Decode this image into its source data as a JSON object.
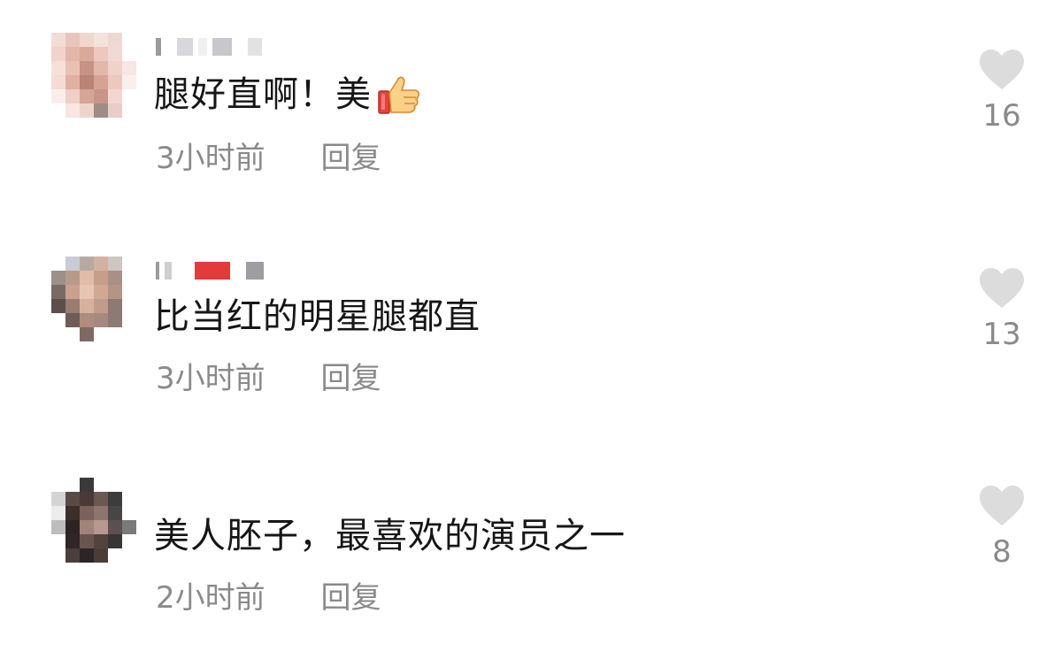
{
  "comments": [
    {
      "username": "",
      "text": "腿好直啊！美",
      "has_thumbs_emoji": true,
      "time": "3小时前",
      "reply_label": "回复",
      "like_count": "16",
      "avatar_colors": [
        "#f3dcd6",
        "#e7c5bd",
        "#f1d6cf",
        "#f5e2dd",
        "#f0d8d2",
        "#ffffff",
        "#f2d2ca",
        "#e3b6ab",
        "#d9a99c",
        "#ecc8be",
        "#f2d9d3",
        "#ffffff",
        "#f6e0da",
        "#e9c0b4",
        "#c69386",
        "#e2b8ac",
        "#efd2ca",
        "#f7e6e1",
        "#f4dbd4",
        "#dfb0a3",
        "#b98474",
        "#d4a395",
        "#ecc9bf",
        "#fbefeb",
        "#fbeeea",
        "#efcfc6",
        "#d6a597",
        "#c7958a",
        "#f2d6cf",
        "#ffffff",
        "#ffffff",
        "#f8e6e1",
        "#efd4cc",
        "#9f8c86",
        "#e9cdc6",
        "#ffffff"
      ]
    },
    {
      "username": "",
      "text": "比当红的明星腿都直",
      "has_thumbs_emoji": false,
      "time": "3小时前",
      "reply_label": "回复",
      "like_count": "13",
      "avatar_colors": [
        "#ffffff",
        "#c9ccd2",
        "#b7a9a2",
        "#d5b1a2",
        "#cfc6c4",
        "#ffffff",
        "#9d8f8a",
        "#b89a8b",
        "#e0bca9",
        "#c79e8c",
        "#a79087",
        "#ffffff",
        "#7a6a64",
        "#c8a190",
        "#e6c5b5",
        "#d1a893",
        "#b49484",
        "#ffffff",
        "#5d4e4a",
        "#9a7c70",
        "#d7b1a0",
        "#c29b8a",
        "#8f7a73",
        "#ffffff",
        "#ffffff",
        "#6f5c56",
        "#b08c7d",
        "#a6897e",
        "#8c7a74",
        "#ffffff",
        "#ffffff",
        "#ffffff",
        "#7e6a63",
        "#ffffff",
        "#ffffff",
        "#ffffff"
      ]
    },
    {
      "username": "",
      "text": "美人胚子，最喜欢的演员之一",
      "has_thumbs_emoji": false,
      "time": "2小时前",
      "reply_label": "回复",
      "like_count": "8",
      "avatar_colors": [
        "#ffffff",
        "#ffffff",
        "#3a3a3a",
        "#ffffff",
        "#ffffff",
        "#ffffff",
        "#d4d4d4",
        "#5a4a46",
        "#4a3a37",
        "#6b5853",
        "#3c3c3c",
        "#ffffff",
        "#ececec",
        "#3b2e2b",
        "#7a625c",
        "#8e746e",
        "#4a4545",
        "#ffffff",
        "#bdbdbd",
        "#2c2424",
        "#a0837c",
        "#b69891",
        "#5a5050",
        "#7a7a7a",
        "#ffffff",
        "#2f2727",
        "#6a5450",
        "#53433f",
        "#3a3535",
        "#ffffff",
        "#ffffff",
        "#4a3f3d",
        "#2b2525",
        "#4b3c38",
        "#ffffff",
        "#ffffff"
      ]
    }
  ],
  "username_blocks": [
    [
      [
        "#9a9aa0",
        6
      ],
      [
        "#ffffff",
        6
      ],
      [
        "#d8d8dc",
        18
      ],
      [
        "#f0f0f0",
        10
      ],
      [
        "#c8c8cc",
        22
      ],
      [
        "#ffffff",
        6
      ],
      [
        "#e2e2e4",
        16
      ]
    ],
    [
      [
        "#9a9aa0",
        4
      ],
      [
        "#cfcfd3",
        8
      ],
      [
        "#ffffff",
        14
      ],
      [
        "#e53a3a",
        40
      ],
      [
        "#ffffff",
        6
      ],
      [
        "#9d9da2",
        20
      ]
    ],
    []
  ],
  "icons": {
    "like": "heart-icon",
    "emoji": "thumbs-up-icon"
  },
  "colors": {
    "text": "#161616",
    "meta": "#8a8a8a",
    "heart": "#dcdcdc"
  }
}
